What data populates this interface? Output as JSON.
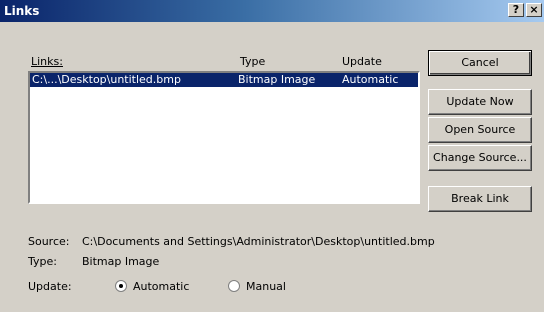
{
  "window": {
    "title": "Links",
    "help_label": "?",
    "close_label": "×"
  },
  "list": {
    "headers": {
      "links": "Links:",
      "type": "Type",
      "update": "Update"
    },
    "rows": [
      {
        "link": "C:\\...\\Desktop\\untitled.bmp",
        "type": "Bitmap Image",
        "update": "Automatic"
      }
    ]
  },
  "buttons": {
    "cancel": "Cancel",
    "update_now": "Update Now",
    "open_source": "Open Source",
    "change_source": "Change Source...",
    "break_link": "Break Link"
  },
  "details": {
    "source_label": "Source:",
    "source_value": "C:\\Documents and Settings\\Administrator\\Desktop\\untitled.bmp",
    "type_label": "Type:",
    "type_value": "Bitmap Image",
    "update_label": "Update:",
    "automatic_label": "Automatic",
    "manual_label": "Manual",
    "update_mode": "Automatic"
  },
  "colors": {
    "title_bar": "#0a246a",
    "selection": "#0a246a",
    "face": "#d4d0c8"
  }
}
